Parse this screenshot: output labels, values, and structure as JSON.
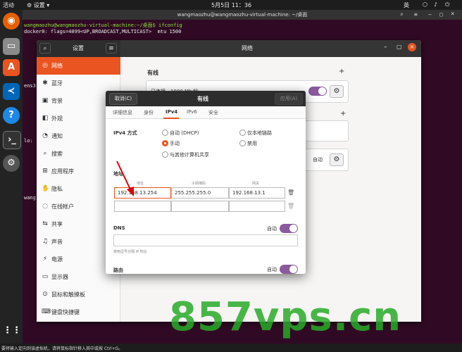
{
  "topbar": {
    "activities": "活动",
    "settings_menu": "设置",
    "clock": "5月5日  11：36",
    "lang": "英"
  },
  "dock": {
    "items": [
      "firefox-icon",
      "files-icon",
      "software-icon",
      "vscode-icon",
      "help-icon",
      "terminal-icon",
      "settings-icon"
    ],
    "apps_grid": "apps-grid-icon"
  },
  "terminal": {
    "title": "wangmaozhu@wangmaozhu-virtual-machine: ~/桌面",
    "prompt": "wangmaozhu@wangmaozhu-virtual-machine:~/桌面$ ifconfig",
    "line2": "docker0: flags=4099<UP,BROADCAST,MULTICAST>  mtu 1500",
    "frag_ens": "ens3",
    "frag_lo": "lo:",
    "frag_wang": "wang"
  },
  "settings": {
    "title": "设置",
    "pane_title": "网络",
    "sidebar": [
      {
        "label": "网络",
        "icon": "network-icon"
      },
      {
        "label": "蓝牙",
        "icon": "bluetooth-icon"
      },
      {
        "label": "背景",
        "icon": "background-icon"
      },
      {
        "label": "外观",
        "icon": "appearance-icon"
      },
      {
        "label": "通知",
        "icon": "notification-icon"
      },
      {
        "label": "搜索",
        "icon": "search-icon"
      },
      {
        "label": "应用程序",
        "icon": "apps-icon"
      },
      {
        "label": "隐私",
        "icon": "privacy-icon"
      },
      {
        "label": "在线帐户",
        "icon": "online-accounts-icon"
      },
      {
        "label": "共享",
        "icon": "share-icon"
      },
      {
        "label": "声音",
        "icon": "sound-icon"
      },
      {
        "label": "电源",
        "icon": "power-icon"
      },
      {
        "label": "显示器",
        "icon": "display-icon"
      },
      {
        "label": "鼠标和触摸板",
        "icon": "mouse-icon"
      },
      {
        "label": "键盘快捷键",
        "icon": "keyboard-icon"
      }
    ],
    "wired_header": "有线",
    "wired_row": "已连接 - 1000 Mb/秒",
    "add": "+",
    "auto": "自动"
  },
  "dialog": {
    "cancel": "取消(C)",
    "title": "有线",
    "apply": "应用(A)",
    "tabs": [
      "详细信息",
      "身份",
      "IPv4",
      "IPv6",
      "安全"
    ],
    "active_tab": 2,
    "ipv4_method_label": "IPv4 方式",
    "methods": {
      "auto_dhcp": "自动 (DHCP)",
      "link_local": "仅本地链路",
      "manual": "手动",
      "disable": "禁用",
      "share": "与其他计算机共享"
    },
    "address_label": "地址",
    "col_address": "地址",
    "col_netmask": "子网掩码",
    "col_gateway": "网关",
    "row1": {
      "address": "192.168.13.254",
      "netmask": "255.255.255.0",
      "gateway": "192.168.13.1"
    },
    "dns_label": "DNS",
    "dns_auto": "自动",
    "dns_hint": "使用逗号分隔 IP 地址",
    "route_label": "路由",
    "route_auto": "自动",
    "accent": "#e95420",
    "toggle_color": "#8b5a9e"
  },
  "bottombar": {
    "message": "要将输入定向到该虚拟机，请将鼠标指针移入其中或按 Ctrl+G。"
  },
  "watermark": "857vps.cn"
}
